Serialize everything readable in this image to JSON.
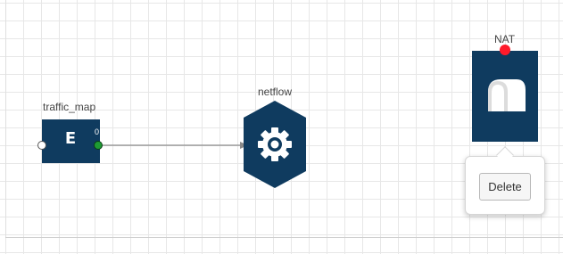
{
  "canvas": {
    "background": "#ffffff",
    "grid_color": "#e7e7e7"
  },
  "nodes": {
    "traffic_map": {
      "label": "traffic_map",
      "glyph": "E",
      "output_port_index": "0",
      "icon": "traffic-map-icon",
      "color": "#0f3b5f",
      "output_port_color": "#1e9a33"
    },
    "netflow": {
      "label": "netflow",
      "icon": "gear-icon",
      "color": "#0f3b5f"
    },
    "nat": {
      "label": "NAT",
      "icon": "mailbox-icon",
      "color": "#0f3b5f",
      "input_port_color": "#ff1a2a"
    }
  },
  "connections": [
    {
      "from": "traffic_map",
      "to": "netflow"
    }
  ],
  "context_menu": {
    "delete_label": "Delete"
  }
}
